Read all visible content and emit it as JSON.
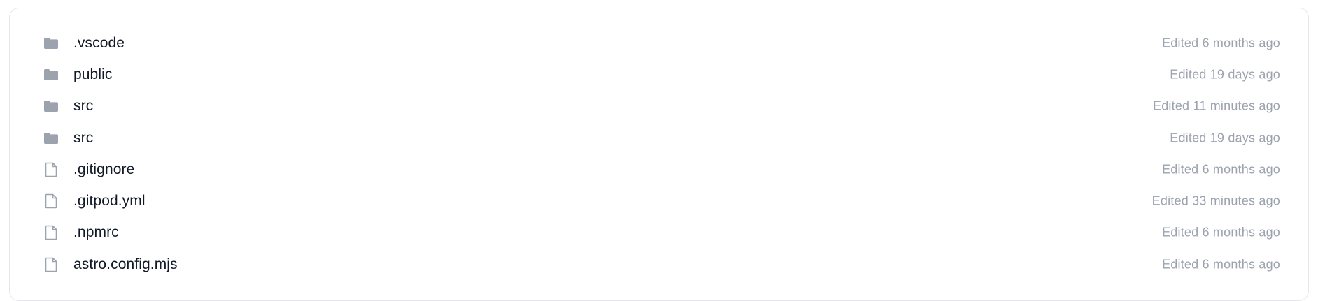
{
  "files": [
    {
      "name": ".vscode",
      "type": "folder",
      "icon": "folder-icon",
      "edited": "Edited 6 months ago"
    },
    {
      "name": "public",
      "type": "folder",
      "icon": "folder-icon",
      "edited": "Edited 19 days ago"
    },
    {
      "name": "src",
      "type": "folder",
      "icon": "folder-icon",
      "edited": "Edited 11 minutes ago"
    },
    {
      "name": "src",
      "type": "folder",
      "icon": "folder-icon",
      "edited": "Edited 19 days ago"
    },
    {
      "name": ".gitignore",
      "type": "file",
      "icon": "file-icon",
      "edited": "Edited 6 months ago"
    },
    {
      "name": ".gitpod.yml",
      "type": "file",
      "icon": "file-icon",
      "edited": "Edited 33 minutes ago"
    },
    {
      "name": ".npmrc",
      "type": "file",
      "icon": "file-icon",
      "edited": "Edited 6 months ago"
    },
    {
      "name": "astro.config.mjs",
      "type": "file",
      "icon": "file-icon",
      "edited": "Edited 6 months ago"
    }
  ],
  "colors": {
    "icon": "#9ca3af",
    "name_text": "#111827",
    "muted_text": "#9ca3af",
    "border": "#e5e7eb"
  }
}
